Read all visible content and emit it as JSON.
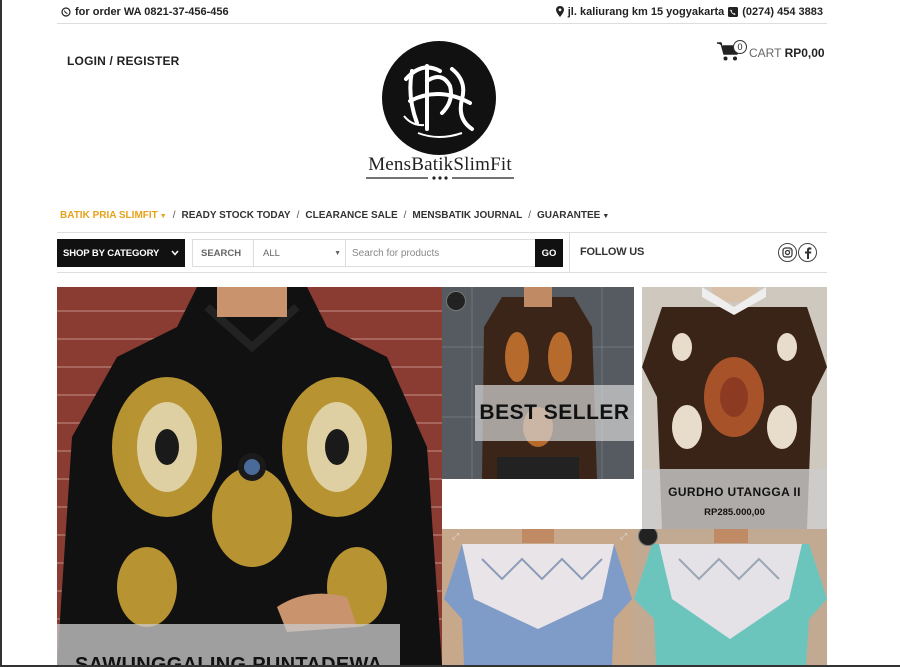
{
  "topbar": {
    "order_text": "for order WA 0821-37-456-456",
    "address": "jl. kaliurang km 15 yogyakarta",
    "phone": "(0274) 454 3883"
  },
  "header": {
    "login_register": "LOGIN / REGISTER",
    "logo_text": "MensBatikSlimFit",
    "cart_count": "0",
    "cart_label": "CART",
    "cart_total": "RP0,00"
  },
  "nav": {
    "items": [
      {
        "label": "BATIK PRIA SLIMFIT",
        "has_dropdown": true,
        "active": true
      },
      {
        "label": "READY STOCK TODAY",
        "has_dropdown": false
      },
      {
        "label": "CLEARANCE SALE",
        "has_dropdown": false
      },
      {
        "label": "MENSBATIK JOURNAL",
        "has_dropdown": false
      },
      {
        "label": "GUARANTEE",
        "has_dropdown": true
      }
    ],
    "separator": "/"
  },
  "search": {
    "shop_by_category": "SHOP BY CATEGORY",
    "label": "SEARCH",
    "category_value": "ALL",
    "placeholder": "Search for products",
    "go": "GO",
    "follow_us": "FOLLOW US"
  },
  "banner": {
    "best_seller": "BEST SELLER",
    "product_name": "GURDHO UTANGGA II",
    "product_price": "RP285.000,00",
    "hero_title": "SAWUNGGALING PUNTADEWA"
  },
  "colors": {
    "accent": "#e6a21a",
    "dark": "#111111",
    "border": "#dddddd"
  },
  "icons": [
    "whatsapp-icon",
    "location-pin-icon",
    "phone-icon",
    "cart-icon",
    "chevron-down-icon",
    "instagram-icon",
    "facebook-icon"
  ]
}
